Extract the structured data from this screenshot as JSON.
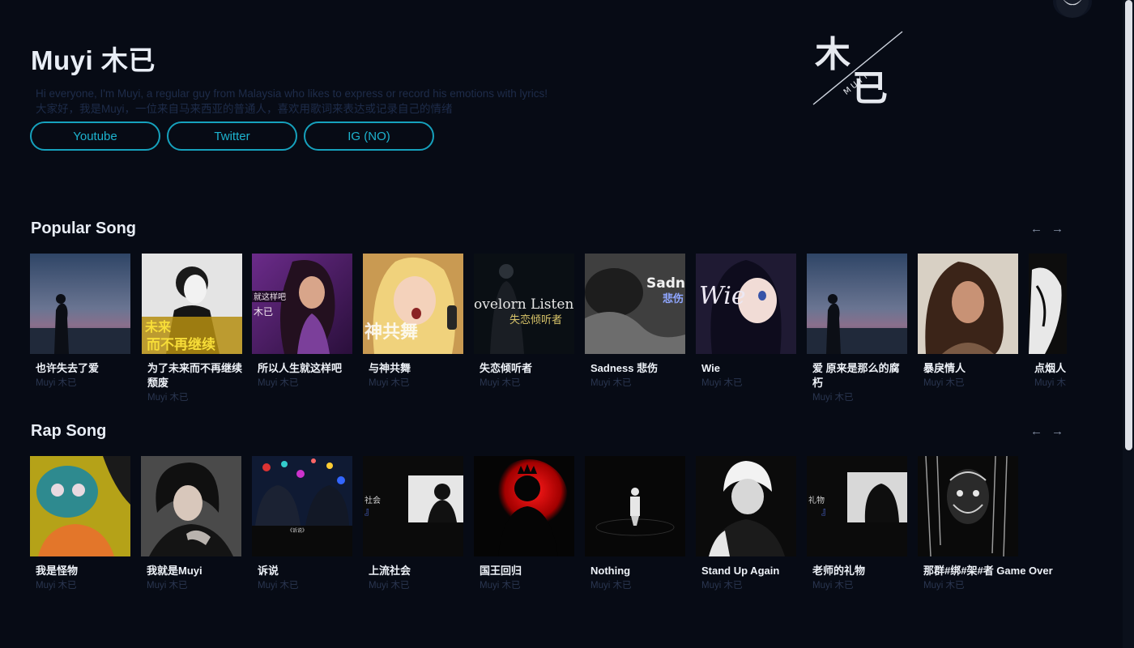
{
  "artist": {
    "name": "Muyi 木已",
    "bio_en": "Hi everyone, I'm Muyi, a regular guy from Malaysia who likes to express or record his emotions with lyrics!",
    "bio_zh": "大家好，我是Muyi，一位来自马来西亚的普通人，喜欢用歌词来表达或记录自己的情绪"
  },
  "links": [
    {
      "label": "Youtube"
    },
    {
      "label": "Twitter"
    },
    {
      "label": "IG (NO)"
    }
  ],
  "logo": {
    "glyph_top": "木",
    "glyph_bottom": "已",
    "text": "MUYI"
  },
  "sections": {
    "popular": {
      "title": "Popular Song",
      "prev_icon": "←",
      "next_icon": "→",
      "songs": [
        {
          "title": "也许失去了爱",
          "artist": "Muyi 木已"
        },
        {
          "title": "为了未来而不再继续颓废",
          "artist": "Muyi 木已",
          "cover_text": "未来 而不再继续"
        },
        {
          "title": "所以人生就这样吧",
          "artist": "Muyi 木已",
          "cover_text": "所以人生就这样吧"
        },
        {
          "title": "与神共舞",
          "artist": "Muyi 木已",
          "cover_text": "与神共舞"
        },
        {
          "title": "失恋倾听者",
          "artist": "Muyi 木已",
          "cover_text": "Lovelorn Listener"
        },
        {
          "title": "Sadness 悲伤",
          "artist": "Muyi 木已",
          "cover_text": "Sadness"
        },
        {
          "title": "Wie",
          "artist": "Muyi 木已",
          "cover_text": "Wie"
        },
        {
          "title": "爱 原来是那么的腐朽",
          "artist": "Muyi 木已"
        },
        {
          "title": "暴戾情人",
          "artist": "Muyi 木已"
        },
        {
          "title": "点烟人",
          "artist": "Muyi 木已"
        }
      ]
    },
    "rap": {
      "title": "Rap Song",
      "prev_icon": "←",
      "next_icon": "→",
      "songs": [
        {
          "title": "我是怪物",
          "artist": "Muyi 木已"
        },
        {
          "title": "我就是Muyi",
          "artist": "Muyi 木已"
        },
        {
          "title": "诉说",
          "artist": "Muyi 木已",
          "cover_text": "《诉说》"
        },
        {
          "title": "上流社会",
          "artist": "Muyi 木已",
          "cover_text": "社会 』"
        },
        {
          "title": "国王回归",
          "artist": "Muyi 木已"
        },
        {
          "title": "Nothing",
          "artist": "Muyi 木已"
        },
        {
          "title": "Stand Up Again",
          "artist": "Muyi 木已"
        },
        {
          "title": "老师的礼物",
          "artist": "Muyi 木已",
          "cover_text": "礼物 』"
        },
        {
          "title": "那群#绑#架#者 Game Over",
          "artist": "Muyi 木已"
        }
      ]
    }
  },
  "colors": {
    "background": "#070b15",
    "accent": "#16a1bd",
    "muted": "#2a3650"
  }
}
